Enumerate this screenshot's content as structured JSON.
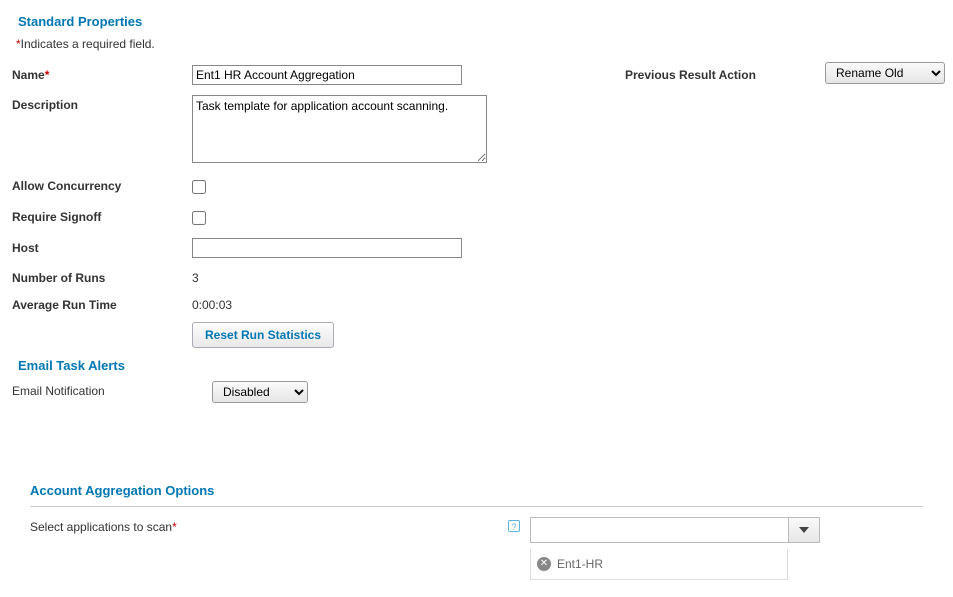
{
  "required_note": {
    "prefix": "*",
    "text": "Indicates a required field."
  },
  "sections": {
    "standard": "Standard Properties",
    "email": "Email Task Alerts",
    "aggr": "Account Aggregation Options"
  },
  "labels": {
    "name": "Name",
    "description": "Description",
    "allow_concurrency": "Allow Concurrency",
    "require_signoff": "Require Signoff",
    "host": "Host",
    "number_of_runs": "Number of Runs",
    "avg_run_time": "Average Run Time",
    "email_notification": "Email Notification",
    "previous_result_action": "Previous Result Action",
    "select_apps": "Select applications to scan"
  },
  "values": {
    "name": "Ent1 HR Account Aggregation",
    "description": "Task template for application account scanning.",
    "host": "",
    "number_of_runs": "3",
    "avg_run_time": "0:00:03",
    "email_notification_selected": "Disabled",
    "previous_result_selected": "Rename Old",
    "app_search": ""
  },
  "options": {
    "email_notification": [
      "Disabled"
    ],
    "previous_result": [
      "Rename Old"
    ]
  },
  "buttons": {
    "reset_stats": "Reset Run Statistics"
  },
  "selected_apps": [
    "Ent1-HR"
  ],
  "help_glyph": "?"
}
